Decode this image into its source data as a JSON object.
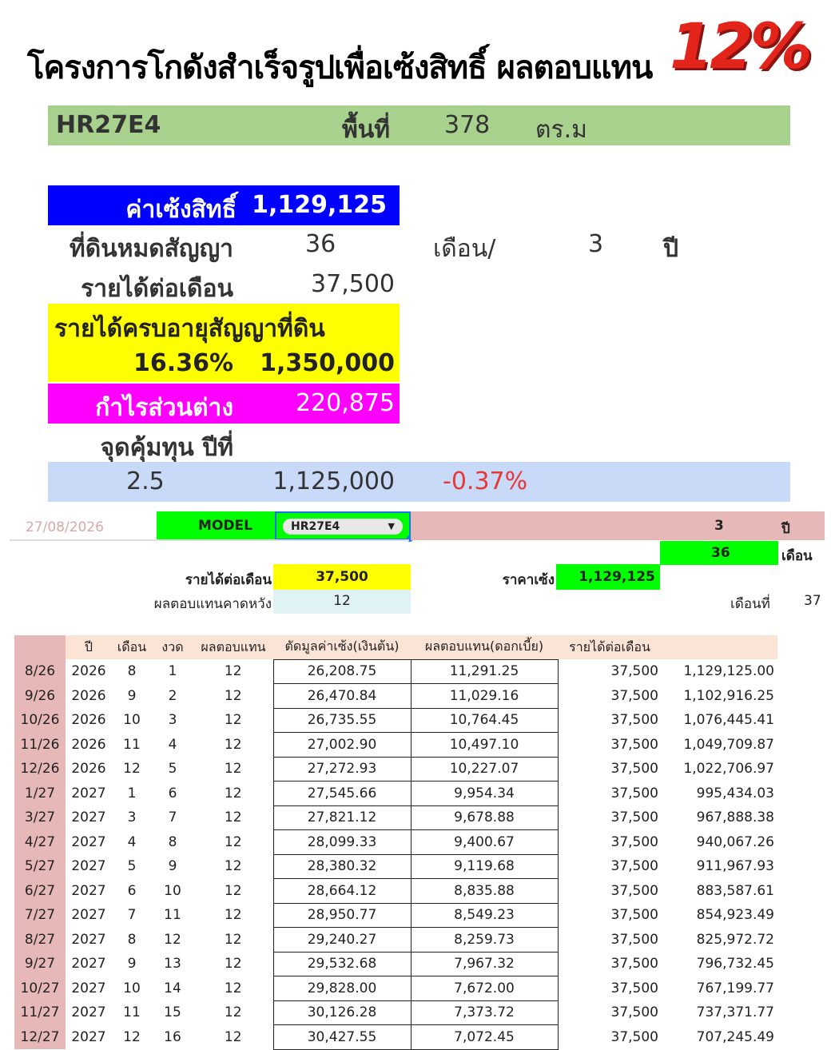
{
  "header": {
    "title": "โครงการโกดังสำเร็จรูปเพื่อเซ้งสิทธิ์ ผลตอบแทน",
    "badge": "12%"
  },
  "summary": {
    "model": "HR27E4",
    "area_label": "พื้นที่",
    "area_value": "378",
    "area_unit": "ตร.ม",
    "fee_label": "ค่าเซ้งสิทธิ์",
    "fee_value": "1,129,125",
    "remaining_label": "ที่ดินหมดสัญญา",
    "remaining_months": "36",
    "months_label": "เดือน/",
    "remaining_years": "3",
    "years_label": "ปี",
    "monthly_label": "รายได้ต่อเดือน",
    "monthly_value": "37,500",
    "total_label": "รายได้ครบอายุสัญญาที่ดิน",
    "total_pct": "16.36%",
    "total_value": "1,350,000",
    "profit_label": "กำไรส่วนต่าง",
    "profit_value": "220,875",
    "breakeven_label": "จุดคุ้มทุน ปีที่",
    "breakeven_year": "2.5",
    "breakeven_value": "1,125,000",
    "breakeven_pct": "-0.37%"
  },
  "sheet": {
    "date": "27/08/2026",
    "model_label": "MODEL",
    "model_value": "HR27E4",
    "years": "3",
    "years_unit": "ปี",
    "months": "36",
    "months_unit": "เดือน",
    "monthly_label": "รายได้ต่อเดือน",
    "monthly_value": "37,500",
    "price_label": "ราคาเซ้ง",
    "price_value": "1,129,125",
    "expected_label": "ผลตอบแทนคาดหวัง",
    "expected_value": "12",
    "month_no_label": "เดือนที่",
    "month_no_value": "37"
  },
  "table": {
    "headers": [
      "",
      "ปี",
      "เดือน",
      "งวด",
      "ผลตอบแทน",
      "ตัดมูลค่าเซ้ง(เงินต้น)",
      "ผลตอบแทน(ดอกเบี้ย)",
      "รายได้ต่อเดือน",
      ""
    ],
    "rows": [
      [
        "8/26",
        "2026",
        "8",
        "1",
        "12",
        "26,208.75",
        "11,291.25",
        "37,500",
        "1,129,125.00"
      ],
      [
        "9/26",
        "2026",
        "9",
        "2",
        "12",
        "26,470.84",
        "11,029.16",
        "37,500",
        "1,102,916.25"
      ],
      [
        "10/26",
        "2026",
        "10",
        "3",
        "12",
        "26,735.55",
        "10,764.45",
        "37,500",
        "1,076,445.41"
      ],
      [
        "11/26",
        "2026",
        "11",
        "4",
        "12",
        "27,002.90",
        "10,497.10",
        "37,500",
        "1,049,709.87"
      ],
      [
        "12/26",
        "2026",
        "12",
        "5",
        "12",
        "27,272.93",
        "10,227.07",
        "37,500",
        "1,022,706.97"
      ],
      [
        "1/27",
        "2027",
        "1",
        "6",
        "12",
        "27,545.66",
        "9,954.34",
        "37,500",
        "995,434.03"
      ],
      [
        "3/27",
        "2027",
        "3",
        "7",
        "12",
        "27,821.12",
        "9,678.88",
        "37,500",
        "967,888.38"
      ],
      [
        "4/27",
        "2027",
        "4",
        "8",
        "12",
        "28,099.33",
        "9,400.67",
        "37,500",
        "940,067.26"
      ],
      [
        "5/27",
        "2027",
        "5",
        "9",
        "12",
        "28,380.32",
        "9,119.68",
        "37,500",
        "911,967.93"
      ],
      [
        "6/27",
        "2027",
        "6",
        "10",
        "12",
        "28,664.12",
        "8,835.88",
        "37,500",
        "883,587.61"
      ],
      [
        "7/27",
        "2027",
        "7",
        "11",
        "12",
        "28,950.77",
        "8,549.23",
        "37,500",
        "854,923.49"
      ],
      [
        "8/27",
        "2027",
        "8",
        "12",
        "12",
        "29,240.27",
        "8,259.73",
        "37,500",
        "825,972.72"
      ],
      [
        "9/27",
        "2027",
        "9",
        "13",
        "12",
        "29,532.68",
        "7,967.32",
        "37,500",
        "796,732.45"
      ],
      [
        "10/27",
        "2027",
        "10",
        "14",
        "12",
        "29,828.00",
        "7,672.00",
        "37,500",
        "767,199.77"
      ],
      [
        "11/27",
        "2027",
        "11",
        "15",
        "12",
        "30,126.28",
        "7,373.72",
        "37,500",
        "737,371.77"
      ],
      [
        "12/27",
        "2027",
        "12",
        "16",
        "12",
        "30,427.55",
        "7,072.45",
        "37,500",
        "707,245.49"
      ]
    ]
  },
  "colors": {
    "model_row": "#a9d18e",
    "fee_block": "#0000ff",
    "total_block": "#ffff00",
    "profit_block": "#ff00ff",
    "breakeven_row": "#c9daf8",
    "badge": "#e3241b",
    "negative": "#e53935"
  }
}
